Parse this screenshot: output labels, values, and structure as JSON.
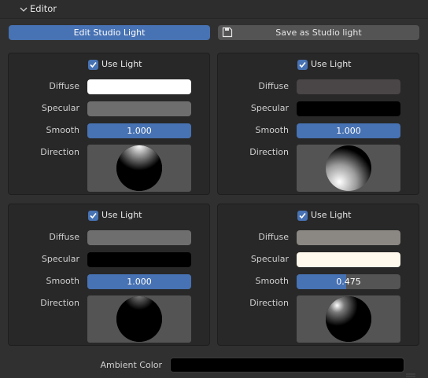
{
  "header": {
    "title": "Editor",
    "collapse_icon": "chevron-down-icon"
  },
  "toolbar": {
    "edit_label": "Edit Studio Light",
    "save_label": "Save as Studio light",
    "save_icon": "save-file-icon"
  },
  "labels": {
    "use_light": "Use Light",
    "diffuse": "Diffuse",
    "specular": "Specular",
    "smooth": "Smooth",
    "direction": "Direction"
  },
  "lights": [
    {
      "use_light": true,
      "diffuse_color": "#ffffff",
      "specular_color": "#6e6e6e",
      "smooth": "1.000",
      "smooth_fraction": 1.0
    },
    {
      "use_light": true,
      "diffuse_color": "#4a4547",
      "specular_color": "#000000",
      "smooth": "1.000",
      "smooth_fraction": 1.0
    },
    {
      "use_light": true,
      "diffuse_color": "#6e6e6e",
      "specular_color": "#000000",
      "smooth": "1.000",
      "smooth_fraction": 1.0
    },
    {
      "use_light": true,
      "diffuse_color": "#8b8782",
      "specular_color": "#fff8ec",
      "smooth": "0.475",
      "smooth_fraction": 0.475
    }
  ],
  "ambient": {
    "label": "Ambient Color",
    "color": "#000000"
  },
  "colors": {
    "accent": "#4772b3",
    "panel": "#303030",
    "card": "#282828",
    "widget": "#545454"
  }
}
